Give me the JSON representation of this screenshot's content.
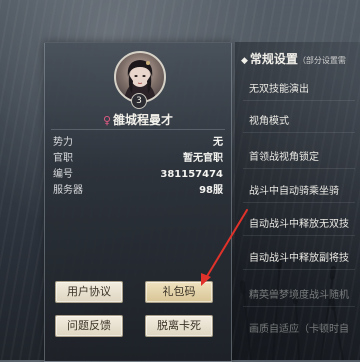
{
  "profile": {
    "level": "3",
    "gender_symbol": "♀",
    "name": "雒城程曼才",
    "rows": [
      {
        "label": "势力",
        "value": "无"
      },
      {
        "label": "官职",
        "value": "暂无官职"
      },
      {
        "label": "编号",
        "value": "381157474"
      },
      {
        "label": "服务器",
        "value": "98服"
      }
    ]
  },
  "buttons": {
    "user_agreement": "用户协议",
    "gift_code": "礼包码",
    "feedback": "问题反馈",
    "unstuck": "脱离卡死"
  },
  "settings": {
    "diamond": "◆",
    "title": "常规设置",
    "subtitle": "（部分设置需",
    "items": [
      "无双技能演出",
      "视角模式",
      "首领战视角锁定",
      "战斗中自动骑乘坐骑",
      "自动战斗中释放无双技",
      "自动战斗中释放副将技",
      "精英兽梦境度战斗随机",
      "画质自适应（卡顿时自"
    ]
  },
  "colors": {
    "annotation_arrow": "#e0322a",
    "gender_female": "#e05a82"
  }
}
